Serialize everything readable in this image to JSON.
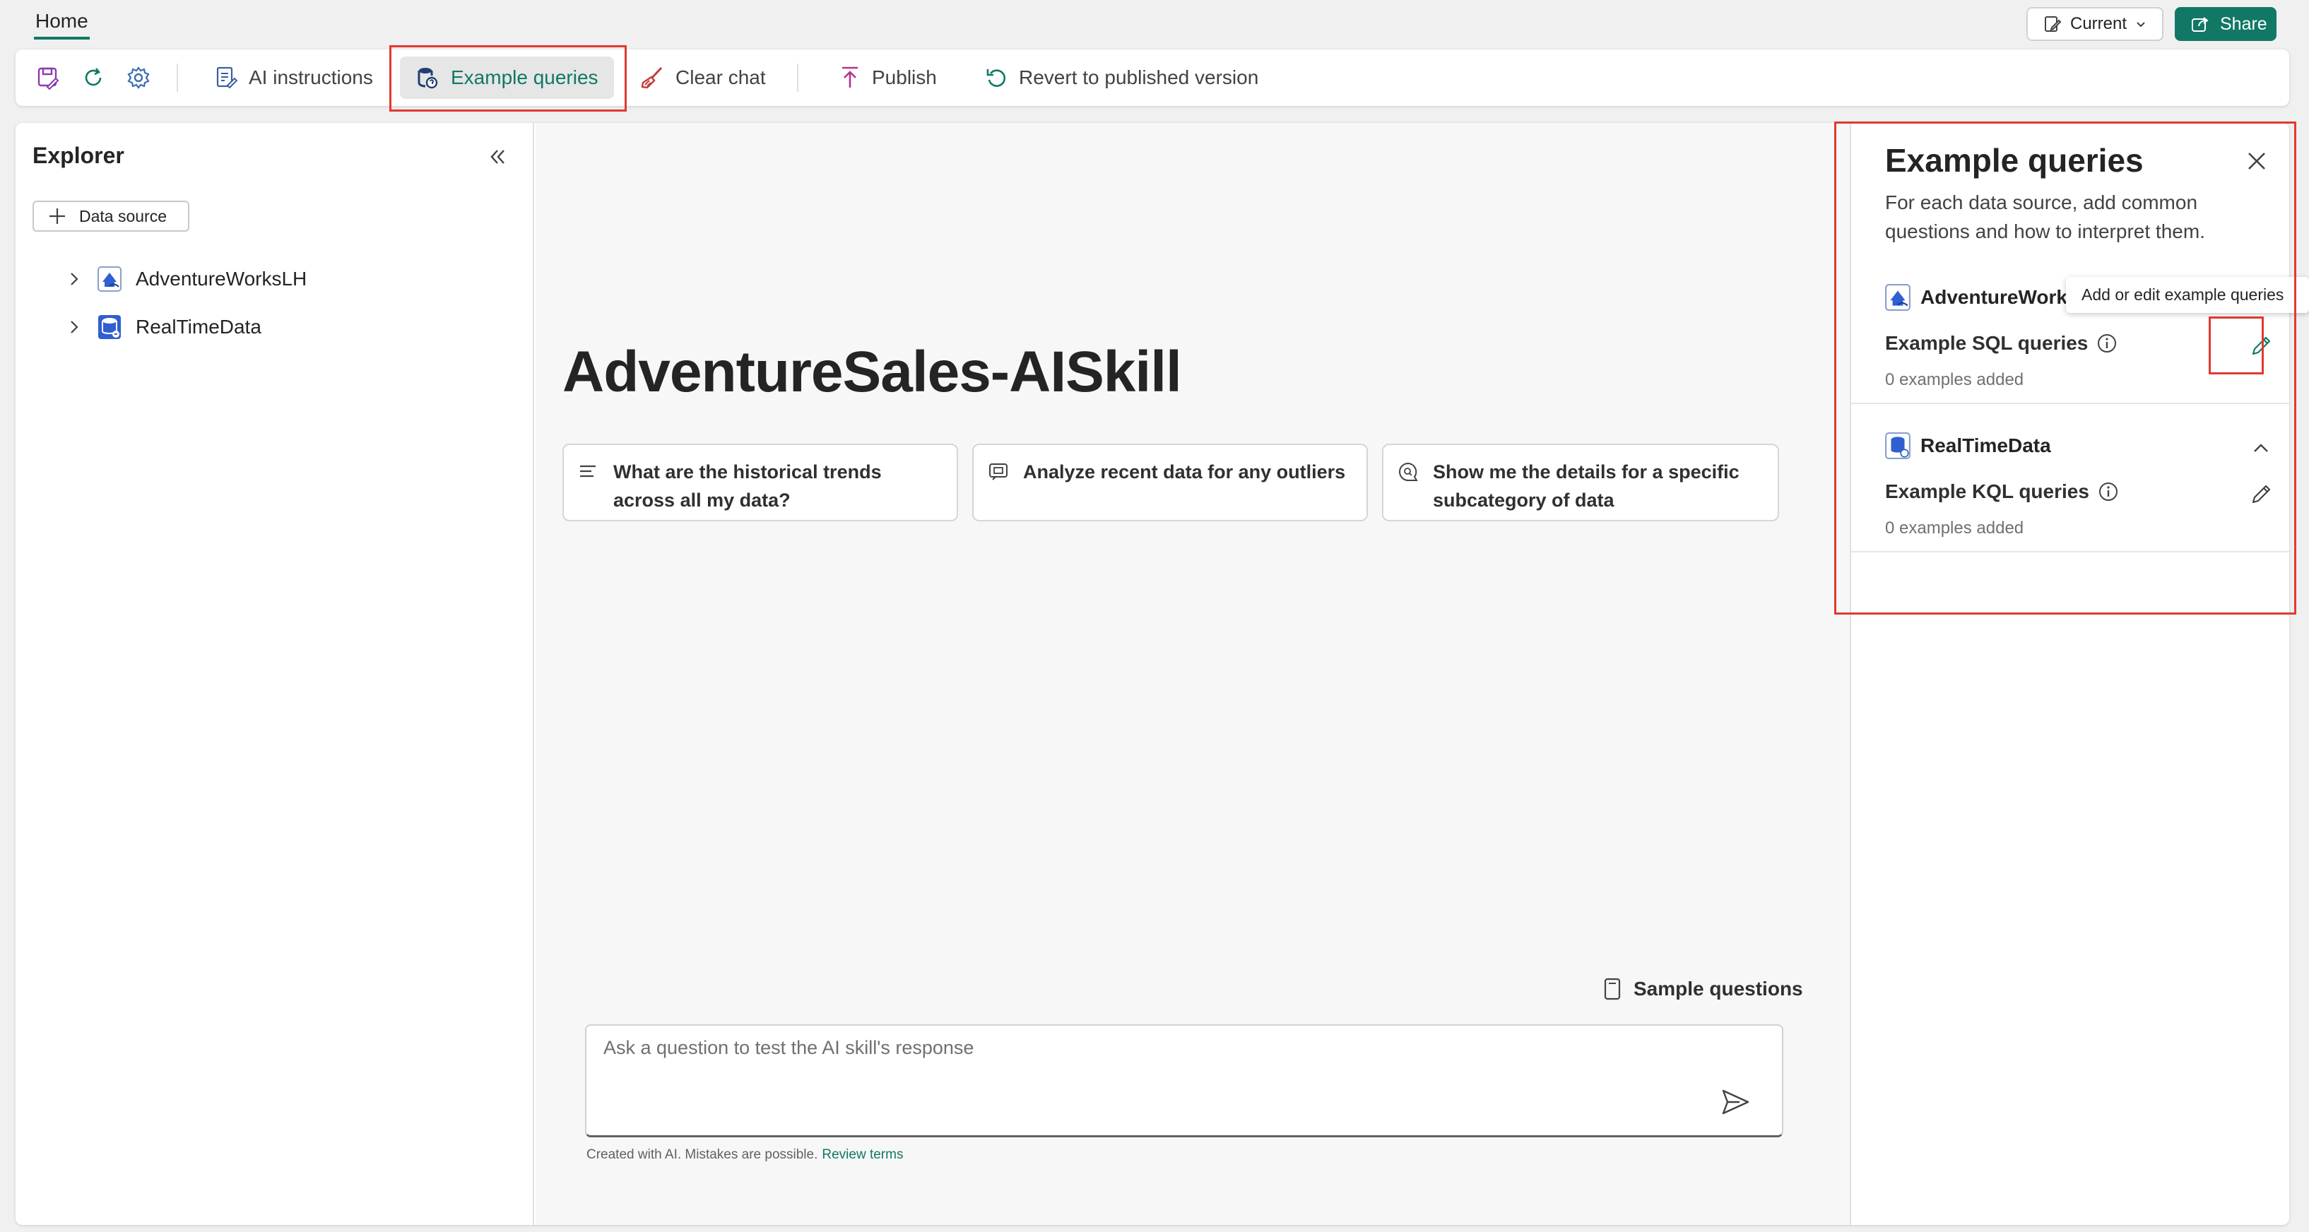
{
  "header": {
    "tab_home": "Home",
    "current_label": "Current",
    "share_label": "Share"
  },
  "toolbar": {
    "ai_instructions": "AI instructions",
    "example_queries": "Example queries",
    "clear_chat": "Clear chat",
    "publish": "Publish",
    "revert": "Revert to published version"
  },
  "explorer": {
    "title": "Explorer",
    "add_source": "Data source",
    "items": [
      {
        "label": "AdventureWorksLH",
        "icon": "lakehouse-icon"
      },
      {
        "label": "RealTimeData",
        "icon": "kql-database-icon"
      }
    ]
  },
  "chat": {
    "title": "AdventureSales-AISkill",
    "suggestions": [
      {
        "text": "What are the historical trends across all my data?",
        "icon": "lines-icon"
      },
      {
        "text": "Analyze recent data for any outliers",
        "icon": "chat-analyze-icon"
      },
      {
        "text": "Show me the details for a specific subcategory of data",
        "icon": "chat-search-icon"
      }
    ],
    "sample_questions": "Sample questions",
    "input_placeholder": "Ask a question to test the AI skill's response",
    "disclaimer": "Created with AI. Mistakes are possible.",
    "review_terms": "Review terms"
  },
  "panel": {
    "title": "Example queries",
    "description": "For each data source, add common questions and how to interpret them.",
    "sources": [
      {
        "name": "AdventureWorksL",
        "query_label": "Example SQL queries",
        "count": "0 examples added"
      },
      {
        "name": "RealTimeData",
        "query_label": "Example KQL queries",
        "count": "0 examples added"
      }
    ],
    "tooltip": "Add or edit example queries"
  },
  "colors": {
    "accent": "#117865",
    "highlight": "#e03a2f"
  }
}
